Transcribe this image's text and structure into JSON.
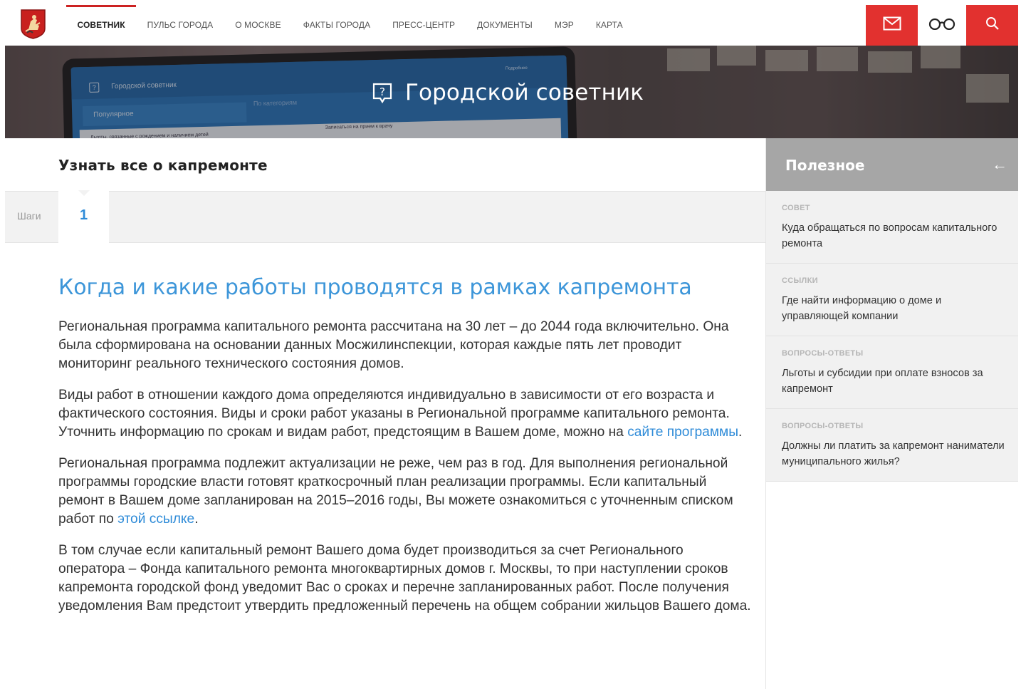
{
  "nav": {
    "items": [
      {
        "label": "СОВЕТНИК",
        "active": true
      },
      {
        "label": "ПУЛЬС ГОРОДА",
        "active": false
      },
      {
        "label": "О МОСКВЕ",
        "active": false
      },
      {
        "label": "ФАКТЫ ГОРОДА",
        "active": false
      },
      {
        "label": "ПРЕСС-ЦЕНТР",
        "active": false
      },
      {
        "label": "ДОКУМЕНТЫ",
        "active": false
      },
      {
        "label": "МЭР",
        "active": false
      },
      {
        "label": "КАРТА",
        "active": false
      }
    ],
    "icons": [
      "mail-icon",
      "glasses-icon",
      "search-icon"
    ],
    "accent_color": "#e2312f"
  },
  "hero": {
    "title": "Городской советник",
    "laptop": {
      "header": "Городской советник",
      "popular": "Популярное",
      "by_category": "По категориям",
      "row_left": "Льготы, связанные с рождением и наличием детей",
      "row_right": "Записаться на прием к врачу",
      "corner": "Подробнее"
    }
  },
  "main": {
    "section_title": "Узнать все о капремонте",
    "steps_label": "Шаги",
    "current_step": "1",
    "article": {
      "title": "Когда и какие работы проводятся в рамках капремонта",
      "p1": "Региональная программа капитального ремонта рассчитана на 30 лет – до 2044 года включительно. Она была сформирована на основании данных Мосжилинспекции, которая каждые пять лет проводит мониторинг реального технического состояния домов.",
      "p2_before": "Виды работ в отношении каждого дома определяются индивидуально в зависимости от его возраста и фактического состояния. Виды и сроки работ указаны в Региональной программе капитального ремонта. Уточнить информацию по срокам и видам работ, предстоящим в Вашем доме, можно на ",
      "p2_link": "сайте программы",
      "p2_after": ".",
      "p3_before": "Региональная программа подлежит актуализации не реже, чем раз в год. Для выполнения региональной программы городские власти готовят краткосрочный план реализации программы. Если капитальный ремонт в Вашем доме запланирован на 2015–2016 годы, Вы можете ознакомиться с уточненным списком работ по ",
      "p3_link": "этой ссылке",
      "p3_after": ".",
      "p4": "В том случае если капитальный ремонт Вашего дома будет производиться за счет Регионального оператора – Фонда капитального ремонта многоквартирных домов г. Москвы, то при наступлении сроков капремонта городской фонд уведомит Вас о сроках и перечне запланированных работ. После получения уведомления Вам предстоит утвердить предложенный перечень на общем собрании жильцов Вашего дома."
    },
    "link_color": "#2e8bd8"
  },
  "sidebar": {
    "title": "Полезное",
    "arrow": "←",
    "items": [
      {
        "category": "СОВЕТ",
        "text": "Куда обращаться по вопросам капитального ремонта"
      },
      {
        "category": "ССЫЛКИ",
        "text": "Где найти информацию о доме и управляющей компании"
      },
      {
        "category": "ВОПРОСЫ-ОТВЕТЫ",
        "text": "Льготы и субсидии при оплате взносов за капремонт"
      },
      {
        "category": "ВОПРОСЫ-ОТВЕТЫ",
        "text": "Должны ли платить за капремонт наниматели муниципального жилья?"
      }
    ]
  }
}
